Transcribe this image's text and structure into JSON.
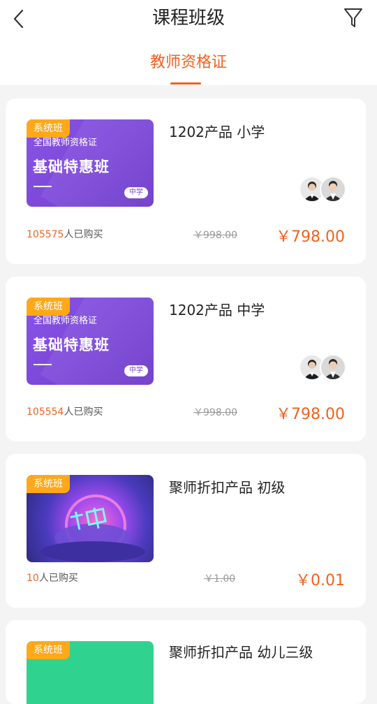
{
  "header": {
    "title": "课程班级",
    "active_tab": "教师资格证"
  },
  "courses": [
    {
      "tag": "系统班",
      "thumb_sub": "全国教师资格证",
      "thumb_main": "基础特惠班",
      "thumb_level": "中学",
      "title": "1202产品 小学",
      "buyers_count": "105575",
      "buyers_suffix": "人已购买",
      "original_price": "￥998.00",
      "price": "￥798.00"
    },
    {
      "tag": "系统班",
      "thumb_sub": "全国教师资格证",
      "thumb_main": "基础特惠班",
      "thumb_level": "中学",
      "title": "1202产品 中学",
      "buyers_count": "105554",
      "buyers_suffix": "人已购买",
      "original_price": "￥998.00",
      "price": "￥798.00"
    },
    {
      "tag": "系统班",
      "title": "聚师折扣产品 初级",
      "buyers_count": "10",
      "buyers_suffix": "人已购买",
      "original_price": "￥1.00",
      "price": "￥0.01"
    },
    {
      "tag": "系统班",
      "title": "聚师折扣产品 幼儿三级"
    }
  ]
}
